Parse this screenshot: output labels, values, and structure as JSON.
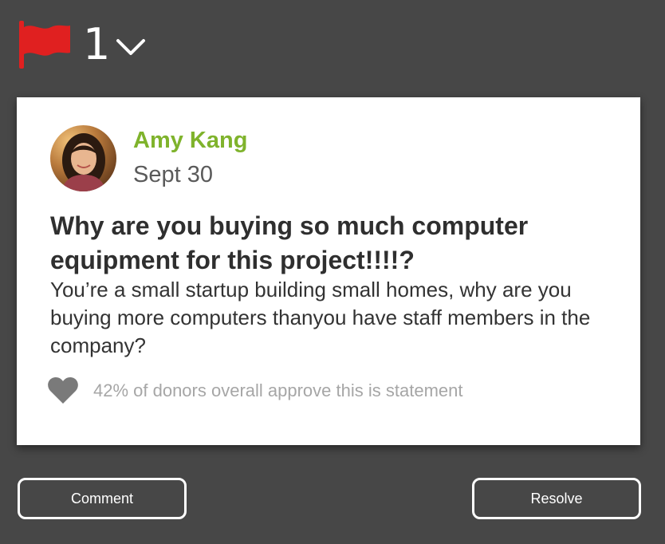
{
  "flag": {
    "icon": "flag-icon",
    "icon_color": "#e02020",
    "count": "1",
    "expand_icon": "chevron-down-icon"
  },
  "post": {
    "author_name": "Amy Kang",
    "author_color": "#7fb32c",
    "date": "Sept 30",
    "title": "Why are you buying so much computer equipment for this project!!!!?",
    "body": "You’re a small startup building small homes, why are you buying more computers thanyou have staff members in the company?",
    "approval_icon": "heart-icon",
    "approval_text": "42% of donors overall approve this is statement"
  },
  "actions": {
    "comment_label": "Comment",
    "resolve_label": "Resolve"
  }
}
